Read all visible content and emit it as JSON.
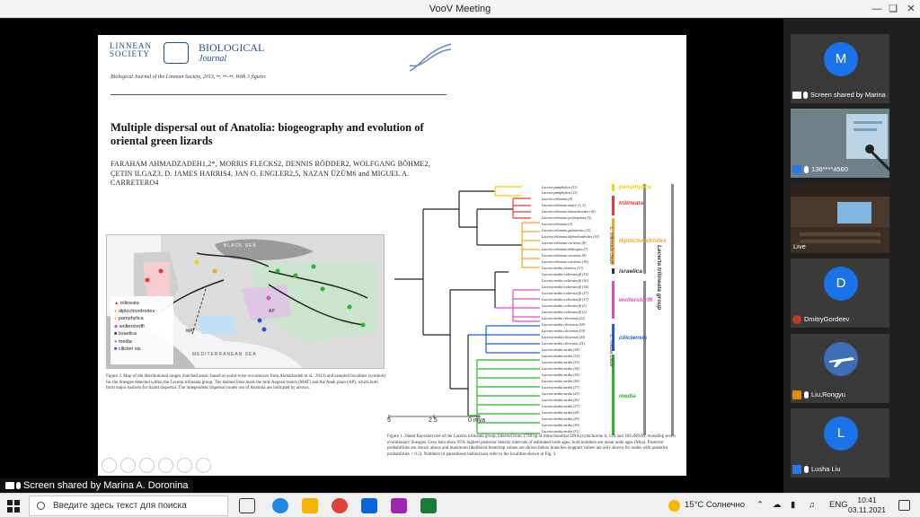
{
  "app": {
    "title": "VooV Meeting"
  },
  "slide": {
    "logo_society": "LINNEAN SOCIETY",
    "logo_journal_top": "BIOLOGICAL",
    "logo_journal_bottom": "Journal",
    "journal_ref": "Biological Journal of the Linnean Society, 2013, ••, ••–••. With 3 figures",
    "title": "Multiple dispersal out of Anatolia: biogeography and evolution of oriental green lizards",
    "authors": "FARAHAM AHMADZADEH1,2*, MORRIS FLECKS2, DENNIS RÖDDER2, WOLFGANG BÖHME2, ÇETIN ILGAZ3, D. JAMES HARRIS4, JAN O. ENGLER2,5, NAZAN ÜZÜM6 and MIGUEL A. CARRETERO4",
    "map_caption": "Figure 3. Map of the distributional ranges (hatched areas; based on point-wise occurrences from Ahmadzadeh et al., 2013) and sampled localities (symbols) for the lineages detected within the Lacerta trilineata group. The dashed lines mark the mid-Aegean trench (MAT) and the Anak plain (AP), which both form major barriers for lizard dispersal. The independent dispersal routes out of Anatolia are indicated by arrows.",
    "map_labels": {
      "black_sea": "BLACK SEA",
      "med_sea": "MEDITERRANEAN SEA",
      "mat": "MAT",
      "ap": "AP"
    },
    "map_legend": [
      "trilineata",
      "diplochondrodes",
      "pamphylica",
      "wolterstorffi",
      "israelica",
      "media",
      "cilicien sis"
    ],
    "tree_caption": "Figure 1. Dated Bayesian tree of the Lacerta trilineata group, inferred from 1728 bp of mitochondrial DNA (cytochrome b, 12S and 16S rRNA), revealing seven evolutionary lineages. Grey bars show 95% highest posterior density intervals of estimated node ages; bold numbers are mean node ages (Mya). Posterior probabilities are shown above and maximum likelihood bootstrap values are shown below branches (support values are only shown for nodes with posterior probabilities > 0.5). Numbers in parenthesis behind taxa refer to the localities shown in Fig. 3.",
    "clades": [
      {
        "name": "pamphylica",
        "color": "#f5d000"
      },
      {
        "name": "trilineata",
        "color": "#e53935"
      },
      {
        "name": "diplochondrodes",
        "color": "#f5a623"
      },
      {
        "name": "israelica",
        "color": "#333333"
      },
      {
        "name": "wolterstorffi",
        "color": "#d84fc2"
      },
      {
        "name": "ciliciensis",
        "color": "#1e5bd8"
      },
      {
        "name": "media",
        "color": "#2bb52b"
      }
    ],
    "side_labels": {
      "trilineata_clade": "L. trilineata clade",
      "media_clade": "L. media clade",
      "group": "Lacerta trilineata group"
    },
    "axis_ticks": [
      "5",
      "2.5",
      "0 mya"
    ]
  },
  "participants": [
    {
      "kind": "avatar",
      "initial": "M",
      "label": "Screen shared by Marina A. Do...",
      "color": "#1a73e8"
    },
    {
      "kind": "video",
      "label": "136****4560"
    },
    {
      "kind": "video",
      "label": "Live"
    },
    {
      "kind": "avatar",
      "initial": "D",
      "label": "DmitryGordeev",
      "color": "#1a73e8"
    },
    {
      "kind": "avatar",
      "initial": "",
      "label": "Liu,Rongyu",
      "color": "#2c5aa0"
    },
    {
      "kind": "avatar",
      "initial": "L",
      "label": "Lusha Liu",
      "color": "#1a73e8"
    }
  ],
  "share_bar": {
    "text": "Screen shared by Marina A. Doronina"
  },
  "taskbar": {
    "search_placeholder": "Введите здесь текст для поиска",
    "weather": "15°C  Солнечно",
    "lang": "ENG",
    "time": "10:41",
    "date": "03.11.2021"
  }
}
